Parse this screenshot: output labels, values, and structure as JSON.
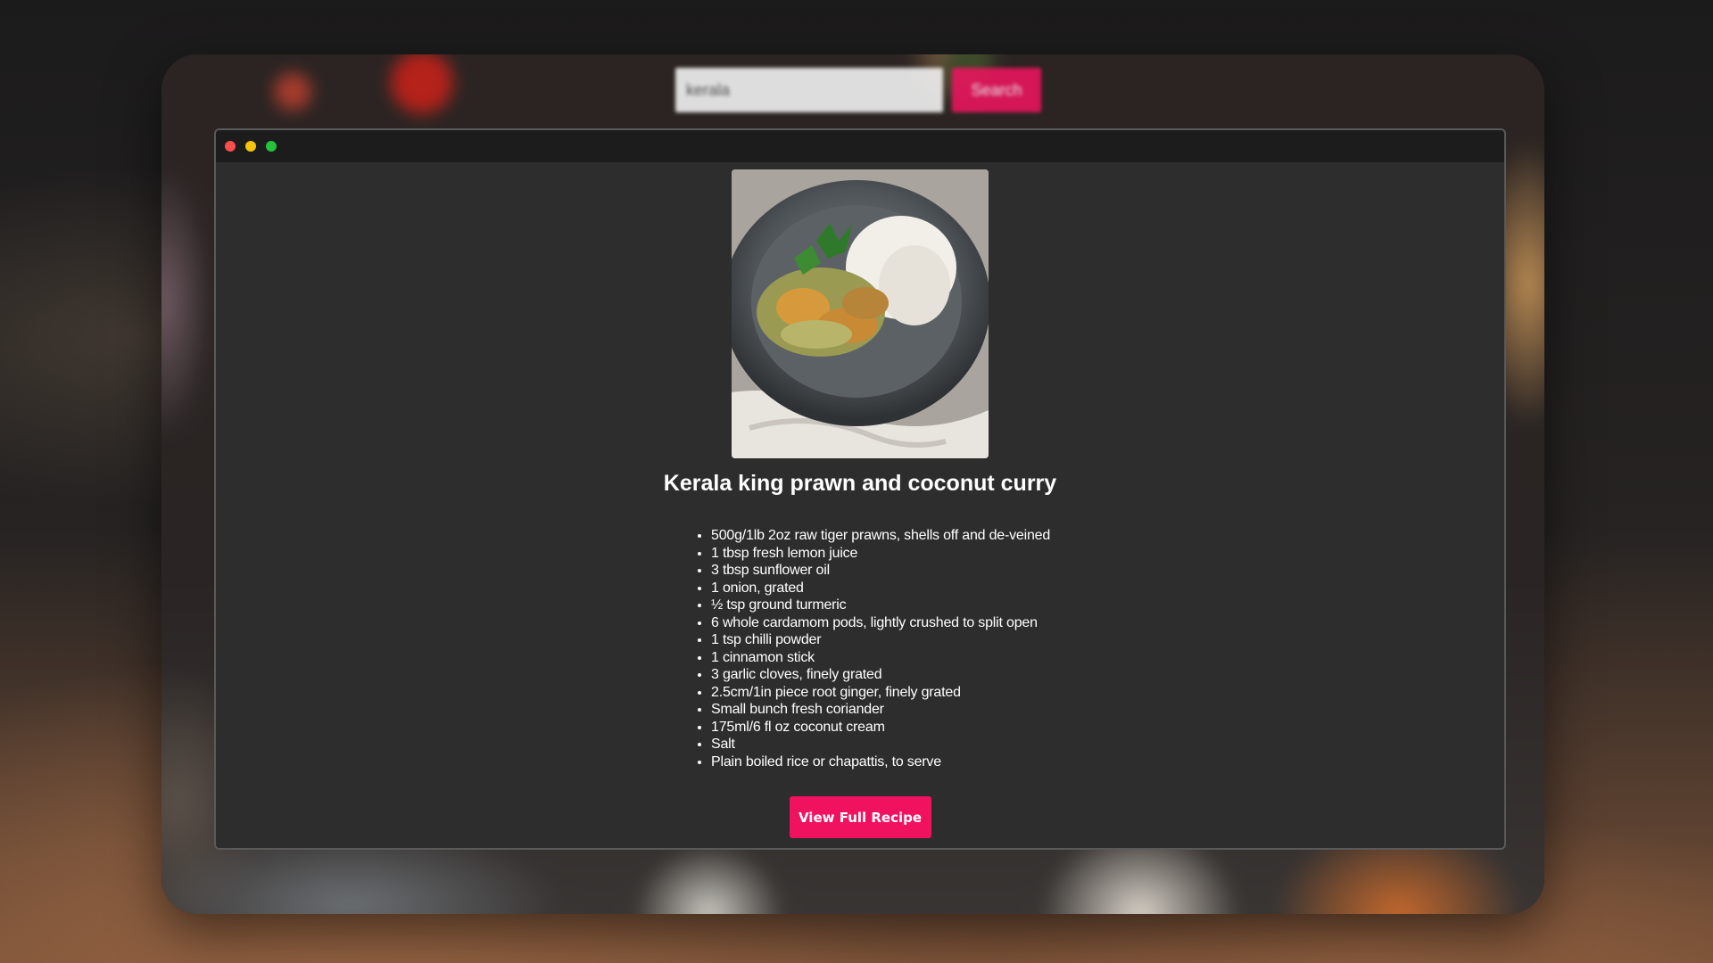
{
  "search": {
    "value": "kerala",
    "button_label": "Search"
  },
  "window_controls": [
    "close",
    "minimize",
    "maximize"
  ],
  "recipe": {
    "title": "Kerala king prawn and coconut curry",
    "image_icon": "curry-photo",
    "ingredients": [
      "500g/1lb 2oz raw tiger prawns, shells off and de-veined",
      "1 tbsp fresh lemon juice",
      "3 tbsp sunflower oil",
      "1 onion, grated",
      "½ tsp ground turmeric",
      "6 whole cardamom pods, lightly crushed to split open",
      "1 tsp chilli powder",
      "1 cinnamon stick",
      "3 garlic cloves, finely grated",
      "2.5cm/1in piece root ginger, finely grated",
      "Small bunch fresh coriander",
      "175ml/6 fl oz coconut cream",
      "Salt",
      "Plain boiled rice or chapattis, to serve"
    ],
    "cta_label": "View Full Recipe"
  },
  "colors": {
    "accent": "#f0125f",
    "modal_bg": "#2d2d2d",
    "titlebar_bg": "#1c1c1c",
    "close": "#ff4c4c",
    "minimize": "#f7c30a",
    "maximize": "#25c23c"
  }
}
